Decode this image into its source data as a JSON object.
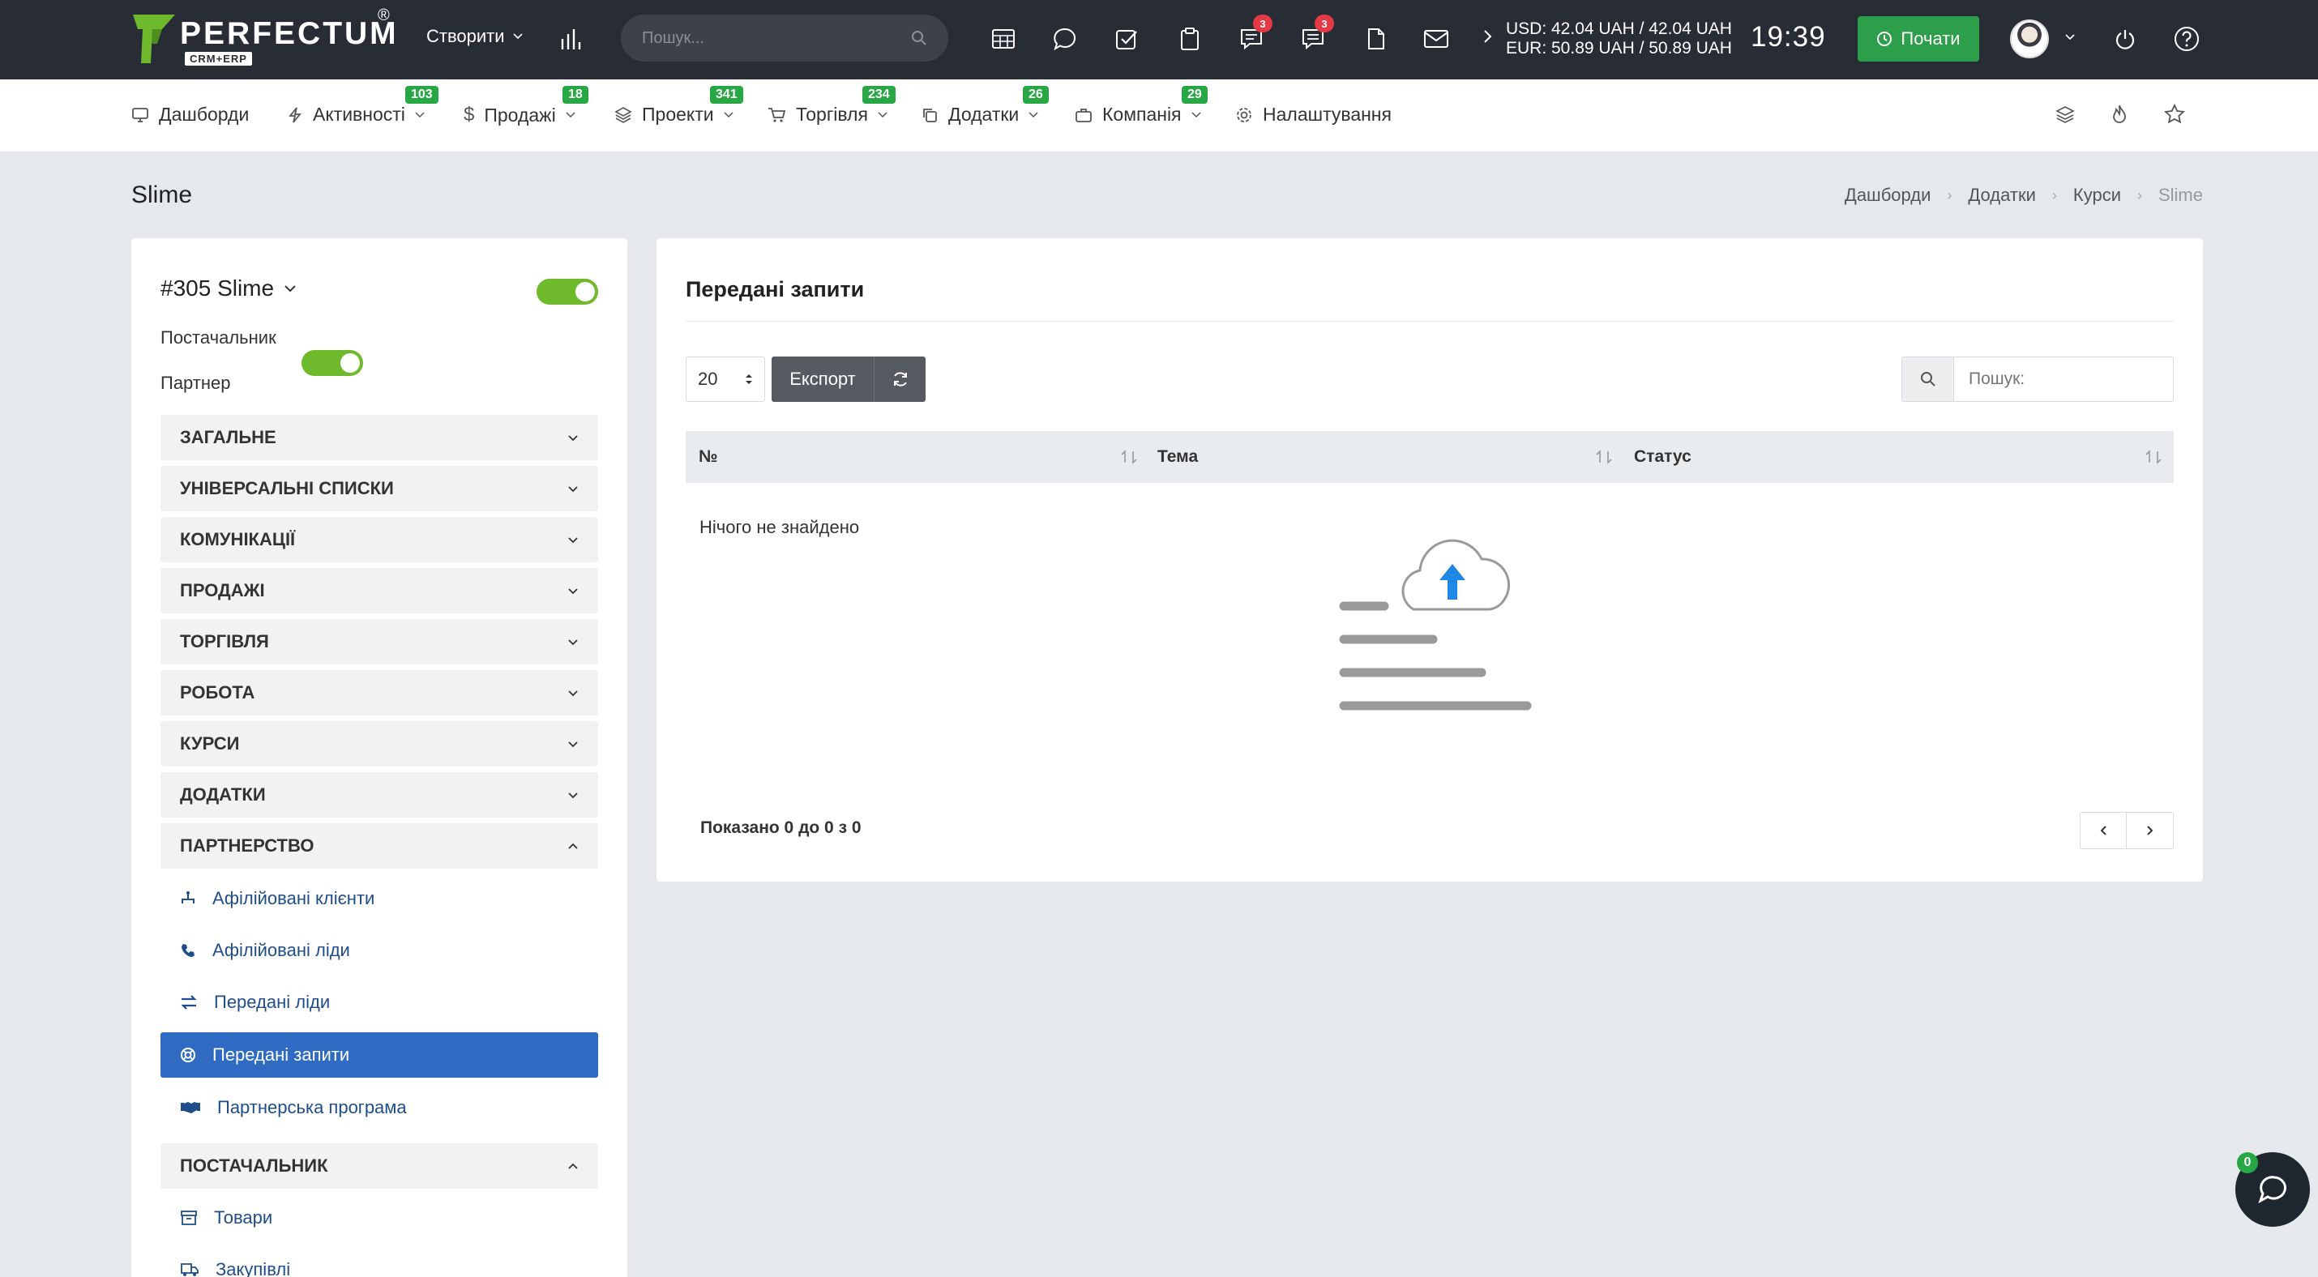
{
  "brand": {
    "name": "PERFECTUM",
    "registered": "®",
    "subtitle": "CRM+ERP"
  },
  "topbar": {
    "create_label": "Створити",
    "search_placeholder": "Пошук...",
    "notifications_count": "3",
    "messages_count": "3",
    "currency_usd": "USD: 42.04 UAH / 42.04 UAH",
    "currency_eur": "EUR: 50.89 UAH / 50.89 UAH",
    "time": "19:39",
    "start_label": "Почати"
  },
  "menu": {
    "items": [
      {
        "label": "Дашборди",
        "badge": ""
      },
      {
        "label": "Активності",
        "badge": "103"
      },
      {
        "label": "Продажі",
        "badge": "18"
      },
      {
        "label": "Проекти",
        "badge": "341"
      },
      {
        "label": "Торгівля",
        "badge": "234"
      },
      {
        "label": "Додатки",
        "badge": "26"
      },
      {
        "label": "Компанія",
        "badge": "29"
      },
      {
        "label": "Налаштування",
        "badge": ""
      }
    ]
  },
  "page": {
    "title": "Slime",
    "breadcrumb": [
      "Дашборди",
      "Додатки",
      "Курси",
      "Slime"
    ]
  },
  "sidebar": {
    "record_title": "#305 Slime",
    "supplier_label": "Постачальник",
    "partner_label": "Партнер",
    "sections": [
      "ЗАГАЛЬНЕ",
      "УНІВЕРСАЛЬНІ СПИСКИ",
      "КОМУНІКАЦІЇ",
      "ПРОДАЖІ",
      "ТОРГІВЛЯ",
      "РОБОТА",
      "КУРСИ",
      "ДОДАТКИ",
      "ПАРТНЕРСТВО"
    ],
    "partnership_items": [
      "Афілійовані клієнти",
      "Афілійовані ліди",
      "Передані ліди",
      "Передані запити",
      "Партнерська програма"
    ],
    "supplier_section": "ПОСТАЧАЛЬНИК",
    "supplier_items": [
      "Товари",
      "Закупівлі"
    ]
  },
  "main": {
    "title": "Передані запити",
    "page_size": "20",
    "export_label": "Експорт",
    "search_placeholder": "Пошук:",
    "columns": [
      "№",
      "Тема",
      "Статус"
    ],
    "empty_text": "Нічого не знайдено",
    "summary": "Показано 0 до 0 з 0"
  },
  "chat": {
    "badge": "0"
  },
  "colors": {
    "topbar": "#282c34",
    "accent_green": "#2d9e4a",
    "active_blue": "#2f6bc3",
    "badge_red": "#e53946",
    "badge_green": "#28a745"
  }
}
